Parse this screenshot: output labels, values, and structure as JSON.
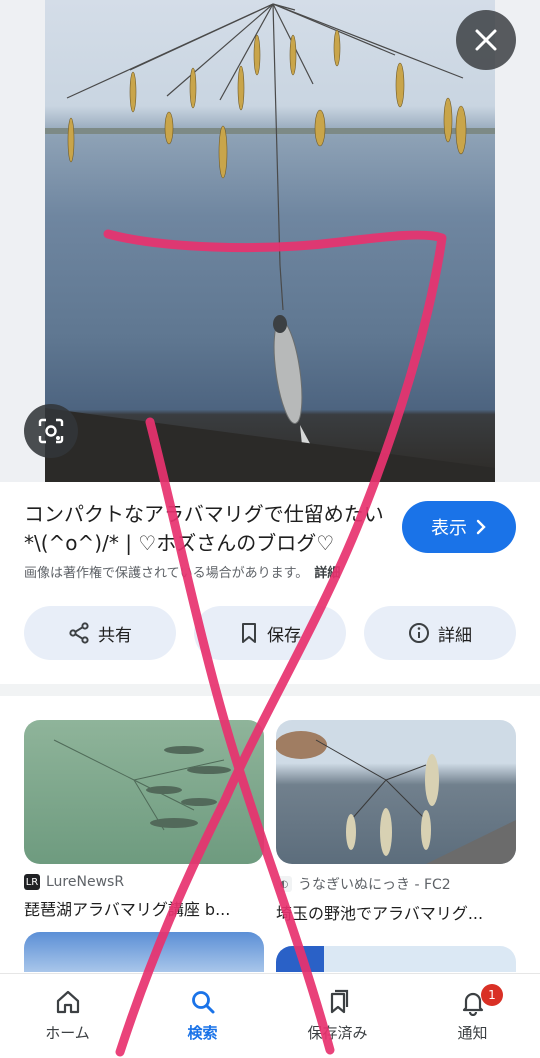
{
  "viewer": {
    "close_icon": "close-icon",
    "lens_icon": "lens-icon"
  },
  "result": {
    "title": "コンパクトなアラバマリグで仕留めたい*\\(^o^)/* | ♡ホズさんのブログ♡",
    "view_label": "表示",
    "copyright_notice": "画像は著作権で保護されている場合があります。",
    "details_link": "詳細"
  },
  "actions": [
    {
      "label": "共有",
      "icon": "share-icon"
    },
    {
      "label": "保存",
      "icon": "bookmark-icon"
    },
    {
      "label": "詳細",
      "icon": "info-icon"
    }
  ],
  "related": [
    {
      "source": "LureNewsR",
      "title": "琵琶湖アラバマリグ講座 b..."
    },
    {
      "source": "うなぎいぬにっき - FC2",
      "title": "埼玉の野池でアラバマリグ..."
    }
  ],
  "bottom_nav": [
    {
      "label": "ホーム",
      "icon": "home-icon"
    },
    {
      "label": "検索",
      "icon": "search-icon",
      "active": true
    },
    {
      "label": "保存済み",
      "icon": "saved-icon"
    },
    {
      "label": "通知",
      "icon": "bell-icon",
      "badge": "1"
    }
  ],
  "colors": {
    "accent": "#1a73e8",
    "badge": "#d93025",
    "annotation": "#e8326f"
  }
}
